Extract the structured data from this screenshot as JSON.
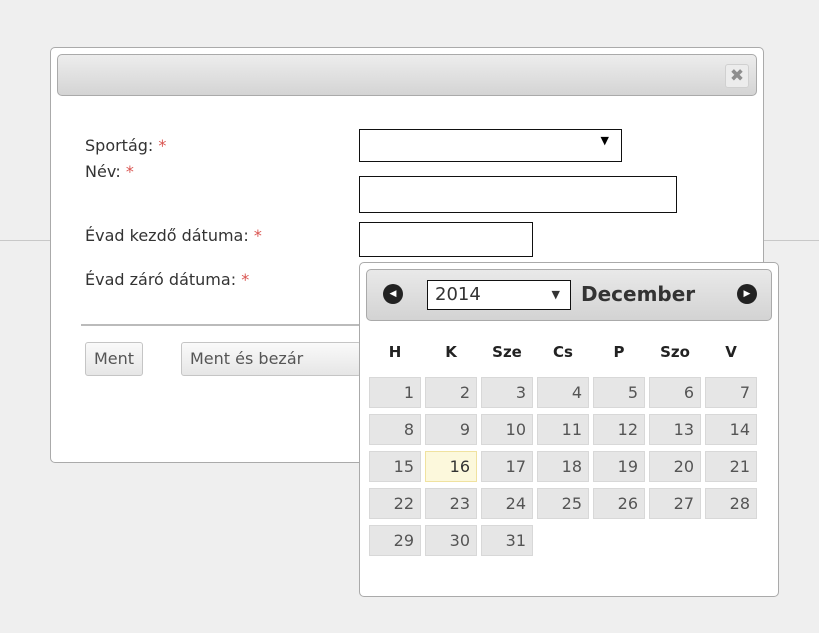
{
  "form": {
    "sportag_label": "Sportág:",
    "nev_label": "Név:",
    "kezdo_label": "Évad kezdő dátuma:",
    "zaro_label": "Évad záró dátuma:",
    "required_mark": "*",
    "close_symbol": "✖",
    "select_arrow": "▼"
  },
  "buttons": {
    "ment": "Ment",
    "ment_bezar": "Ment és bezár"
  },
  "datepicker": {
    "year": "2014",
    "year_arrow": "▼",
    "month": "December",
    "prev_symbol": "◀",
    "next_symbol": "▶",
    "weekdays": [
      "H",
      "K",
      "Sze",
      "Cs",
      "P",
      "Szo",
      "V"
    ],
    "weeks": [
      [
        "1",
        "2",
        "3",
        "4",
        "5",
        "6",
        "7"
      ],
      [
        "8",
        "9",
        "10",
        "11",
        "12",
        "13",
        "14"
      ],
      [
        "15",
        "16",
        "17",
        "18",
        "19",
        "20",
        "21"
      ],
      [
        "22",
        "23",
        "24",
        "25",
        "26",
        "27",
        "28"
      ],
      [
        "29",
        "30",
        "31"
      ]
    ],
    "today": "16",
    "colors": {
      "today_bg": "#fcf8dc",
      "required": "#d9534f"
    }
  }
}
